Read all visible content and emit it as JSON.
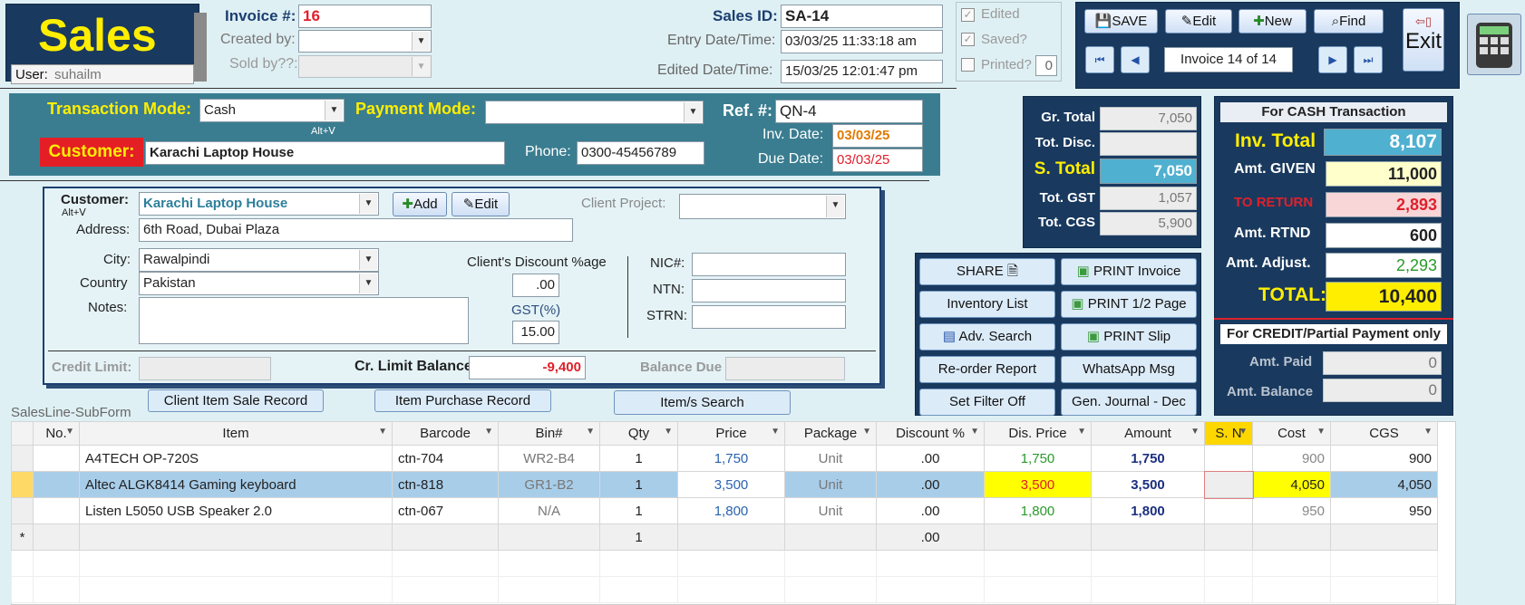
{
  "header": {
    "title": "Sales",
    "user_label": "User:",
    "user_value": "suhailm",
    "invoice_label": "Invoice #:",
    "invoice_value": "16",
    "created_by_label": "Created by:",
    "sold_by_label": "Sold by??:",
    "sales_id_label": "Sales ID:",
    "sales_id_value": "SA-14",
    "entry_label": "Entry Date/Time:",
    "entry_value": "03/03/25 11:33:18 am",
    "edited_label": "Edited Date/Time:",
    "edited_value": "15/03/25 12:01:47 pm",
    "edited_chk": "Edited",
    "saved_chk": "Saved?",
    "printed_chk": "Printed?",
    "printed_count": "0"
  },
  "toolbar": {
    "save": "SAVE",
    "edit": "Edit",
    "new": "New",
    "find": "Find",
    "exit": "Exit",
    "nav_text": "Invoice 14 of 14",
    "first": "⏮",
    "prev": "◀",
    "next": "▶",
    "last": "⏭"
  },
  "transaction": {
    "mode_label": "Transaction Mode:",
    "mode_value": "Cash",
    "alt_hint": "Alt+ᐯ",
    "payment_label": "Payment Mode:",
    "payment_value": "",
    "ref_label": "Ref. #:",
    "ref_value": "QN-4",
    "inv_date_label": "Inv. Date:",
    "inv_date_value": "03/03/25",
    "due_date_label": "Due Date:",
    "due_date_value": "03/03/25",
    "customer_label": "Customer:",
    "customer_value": "Karachi Laptop House",
    "phone_label": "Phone:",
    "phone_value": "0300-45456789"
  },
  "customer": {
    "label": "Customer:",
    "alt_hint": "Alt+ᐯ",
    "value": "Karachi Laptop House",
    "add": "Add",
    "edit": "Edit",
    "project_label": "Client Project:",
    "address_label": "Address:",
    "address_value": "6th Road, Dubai Plaza",
    "city_label": "City:",
    "city_value": "Rawalpindi",
    "country_label": "Country",
    "country_value": "Pakistan",
    "notes_label": "Notes:",
    "discount_label": "Client's  Discount %age",
    "discount_value": ".00",
    "gst_label": "GST(%)",
    "gst_value": "15.00",
    "nic_label": "NIC#:",
    "ntn_label": "NTN:",
    "strn_label": "STRN:",
    "credit_limit_label": "Credit Limit:",
    "cr_balance_label": "Cr. Limit Balance",
    "cr_balance_value": "-9,400",
    "balance_due_label": "Balance Due"
  },
  "totals": {
    "gr_total_label": "Gr. Total",
    "gr_total_value": "7,050",
    "tot_disc_label": "Tot. Disc.",
    "tot_disc_value": "",
    "s_total_label": "S. Total",
    "s_total_value": "7,050",
    "tot_gst_label": "Tot. GST",
    "tot_gst_value": "1,057",
    "tot_cgs_label": "Tot. CGS",
    "tot_cgs_value": "5,900"
  },
  "cash": {
    "header": "For CASH Transaction",
    "inv_total_label": "Inv. Total",
    "inv_total_value": "8,107",
    "amt_given_label": "Amt. GIVEN",
    "amt_given_value": "11,000",
    "to_return_label": "TO RETURN",
    "to_return_value": "2,893",
    "amt_rtnd_label": "Amt. RTND",
    "amt_rtnd_value": "600",
    "amt_adjust_label": "Amt. Adjust.",
    "amt_adjust_value": "2,293",
    "total_label": "TOTAL:",
    "total_value": "10,400",
    "credit_header": "For CREDIT/Partial Payment only",
    "amt_paid_label": "Amt. Paid",
    "amt_paid_value": "0",
    "amt_balance_label": "Amt.  Balance",
    "amt_balance_value": "0"
  },
  "actions": {
    "share": "SHARE",
    "print_invoice": "PRINT Invoice",
    "inventory_list": "Inventory List",
    "print_half": "PRINT 1/2 Page",
    "adv_search": "Adv. Search",
    "print_slip": "PRINT Slip",
    "reorder": "Re-order Report",
    "whatsapp": "WhatsApp Msg",
    "set_filter": "Set Filter Off",
    "gen_journal": "Gen. Journal - Dec"
  },
  "subform": {
    "label": "SalesLine-SubForm",
    "client_item_btn": "Client Item Sale Record",
    "item_purchase_btn": "Item Purchase Record",
    "items_search_btn": "Item/s Search",
    "columns": [
      "No.",
      "Item",
      "Barcode",
      "Bin#",
      "Qty",
      "Price",
      "Package",
      "Discount %",
      "Dis. Price",
      "Amount",
      "S. N",
      "Cost",
      "CGS"
    ],
    "rows": [
      {
        "no": "",
        "item": "A4TECH OP-720S",
        "barcode": "ctn-704",
        "bin": "WR2-B4",
        "qty": "1",
        "price": "1,750",
        "package": "Unit",
        "discount": ".00",
        "dis_price": "1,750",
        "amount": "1,750",
        "sn": "",
        "cost": "900",
        "cgs": "900"
      },
      {
        "no": "",
        "item": "Altec ALGK8414 Gaming keyboard",
        "barcode": "ctn-818",
        "bin": "GR1-B2",
        "qty": "1",
        "price": "3,500",
        "package": "Unit",
        "discount": ".00",
        "dis_price": "3,500",
        "amount": "3,500",
        "sn": "",
        "cost": "4,050",
        "cgs": "4,050"
      },
      {
        "no": "",
        "item": "Listen L5050 USB Speaker 2.0",
        "barcode": "ctn-067",
        "bin": "N/A",
        "qty": "1",
        "price": "1,800",
        "package": "Unit",
        "discount": ".00",
        "dis_price": "1,800",
        "amount": "1,800",
        "sn": "",
        "cost": "950",
        "cgs": "950"
      }
    ],
    "new_row_marker": "*",
    "new_row_qty": "1",
    "new_row_discount": ".00"
  },
  "colors": {
    "dark_panel": "#19395e",
    "teal_panel": "#3a7d90",
    "title_yellow": "#ffee00",
    "highlight_blue": "#4fb0d0"
  }
}
